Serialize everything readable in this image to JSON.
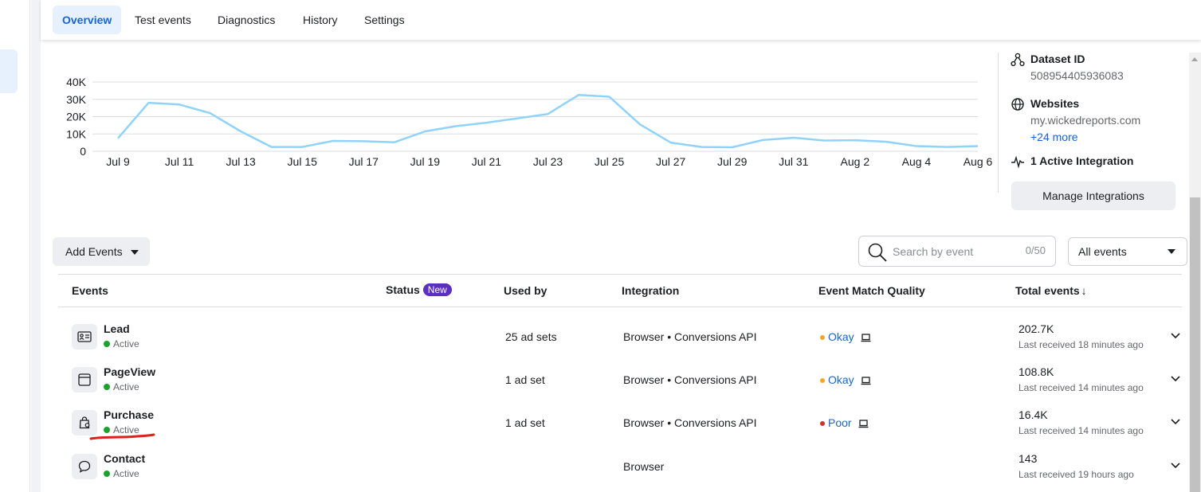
{
  "tabs": [
    {
      "label": "Overview",
      "active": true
    },
    {
      "label": "Test events",
      "active": false
    },
    {
      "label": "Diagnostics",
      "active": false
    },
    {
      "label": "History",
      "active": false
    },
    {
      "label": "Settings",
      "active": false
    }
  ],
  "chart_data": {
    "type": "line",
    "y_ticks": [
      "40K",
      "30K",
      "20K",
      "10K",
      "0"
    ],
    "x_ticks": [
      "Jul 9",
      "Jul 11",
      "Jul 13",
      "Jul 15",
      "Jul 17",
      "Jul 19",
      "Jul 21",
      "Jul 23",
      "Jul 25",
      "Jul 27",
      "Jul 29",
      "Jul 31",
      "Aug 2",
      "Aug 4",
      "Aug 6"
    ],
    "ylim": [
      0,
      40000
    ],
    "x": [
      "Jul 9",
      "Jul 10",
      "Jul 11",
      "Jul 12",
      "Jul 13",
      "Jul 14",
      "Jul 15",
      "Jul 16",
      "Jul 17",
      "Jul 18",
      "Jul 19",
      "Jul 20",
      "Jul 21",
      "Jul 22",
      "Jul 23",
      "Jul 24",
      "Jul 25",
      "Jul 26",
      "Jul 27",
      "Jul 28",
      "Jul 29",
      "Jul 30",
      "Jul 31",
      "Aug 1",
      "Aug 2",
      "Aug 3",
      "Aug 4",
      "Aug 5",
      "Aug 6"
    ],
    "values": [
      7500,
      28000,
      27000,
      22000,
      11500,
      2500,
      2500,
      6000,
      5800,
      5200,
      11500,
      14500,
      16500,
      19000,
      21500,
      32500,
      31500,
      15500,
      5000,
      2500,
      2300,
      6500,
      7800,
      6200,
      6400,
      5500,
      3000,
      2500,
      3000
    ],
    "grid": true,
    "line_color": "#8fd3fb"
  },
  "side_panel": {
    "dataset_id_label": "Dataset ID",
    "dataset_id_value": "508954405936083",
    "websites_label": "Websites",
    "website_value": "my.wickedreports.com",
    "more_link": "+24 more",
    "integration_label": "1 Active Integration",
    "manage_button": "Manage Integrations"
  },
  "toolbar": {
    "add_events_label": "Add Events",
    "search_placeholder": "Search by event",
    "search_count": "0/50",
    "filter_value": "All events"
  },
  "table": {
    "headers": {
      "events": "Events",
      "status": "Status",
      "status_badge": "New",
      "used_by": "Used by",
      "integration": "Integration",
      "emq": "Event Match Quality",
      "total": "Total events",
      "sort_arrow": "↓"
    },
    "rows": [
      {
        "name": "Lead",
        "icon": "contact-card-icon",
        "status": "Active",
        "used_by": "25 ad sets",
        "integration": "Browser • Conversions API",
        "emq": "Okay",
        "emq_color": "#f5a623",
        "total": "202.7K",
        "last_received": "Last received 18 minutes ago"
      },
      {
        "name": "PageView",
        "icon": "browser-window-icon",
        "status": "Active",
        "used_by": "1 ad set",
        "integration": "Browser • Conversions API",
        "emq": "Okay",
        "emq_color": "#f5a623",
        "total": "108.8K",
        "last_received": "Last received 14 minutes ago"
      },
      {
        "name": "Purchase",
        "icon": "shopping-bag-icon",
        "status": "Active",
        "used_by": "1 ad set",
        "integration": "Browser • Conversions API",
        "emq": "Poor",
        "emq_color": "#d32f2f",
        "total": "16.4K",
        "last_received": "Last received 14 minutes ago"
      },
      {
        "name": "Contact",
        "icon": "chat-bubble-icon",
        "status": "Active",
        "used_by": "",
        "integration": "Browser",
        "emq": "",
        "emq_color": "",
        "total": "143",
        "last_received": "Last received 19 hours ago"
      }
    ]
  },
  "annotation_color": "#e0201a"
}
